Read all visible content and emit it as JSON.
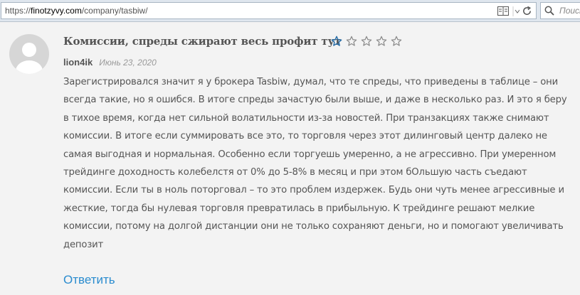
{
  "browser": {
    "url_protocol": "https://",
    "url_host": "finotzyvy.com",
    "url_path": "/company/tasbiw/",
    "search_placeholder": "Поиск"
  },
  "review": {
    "title": "Комиссии, спреды сжирают весь профит тут",
    "rating": 1,
    "max_rating": 5,
    "author": "lion4ik",
    "date": "Июнь 23, 2020",
    "body": "Зарегистрировался значит я у брокера Tasbiw, думал, что те спреды, что приведены в таблице – они всегда такие, но я ошибся. В итоге спреды зачастую были выше, и даже в несколько раз. И это я беру в тихое время, когда нет сильной волатильности из-за новостей. При транзакциях также снимают комиссии. В итоге если суммировать все это, то торговля через этот дилинговый центр далеко не самая выгодная и нормальная. Особенно если торгуешь умеренно, а не агрессивно. При умеренном трейдинге доходность колебелстя от 0% до 5-8% в месяц и при этом бОльшую часть съедают комиссии. Если ты в ноль поторговал – то это проблем издержек. Будь они чуть менее агрессивные и жесткие, тогда бы нулевая торговля превратилась в прибыльную. К трейдинге решают мелкие комиссии, потому на долгой дистанции они не только сохраняют деньги, но и помогают увеличивать депозит",
    "reply_label": "Ответить"
  },
  "colors": {
    "star_filled": "#2a6fa8",
    "star_empty": "#888888",
    "link": "#2a8ccf",
    "text": "#555555"
  }
}
